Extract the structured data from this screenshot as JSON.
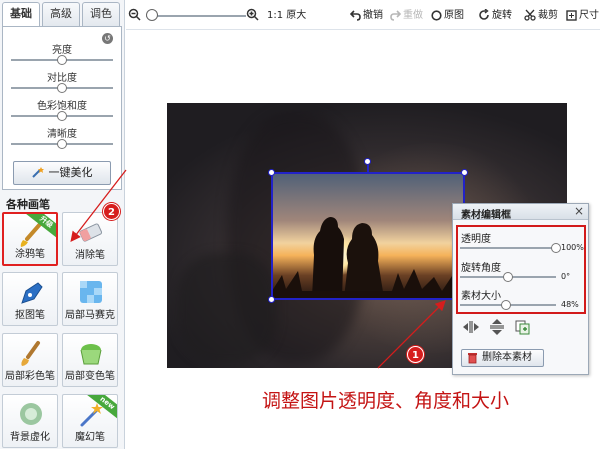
{
  "left_panel": {
    "tabs": [
      {
        "label": "基础",
        "active": true
      },
      {
        "label": "高级",
        "active": false
      },
      {
        "label": "调色",
        "active": false
      }
    ],
    "adjustments": [
      {
        "label": "亮度",
        "value_pct": 50
      },
      {
        "label": "对比度",
        "value_pct": 50
      },
      {
        "label": "色彩饱和度",
        "value_pct": 50
      },
      {
        "label": "清晰度",
        "value_pct": 50
      }
    ],
    "reset_icon": "reset-icon",
    "beautify_label": "一键美化",
    "section_title": "各种画笔",
    "tools": [
      {
        "label": "涂鸦笔",
        "icon": "brush-icon",
        "selected": true,
        "ribbon": "升级"
      },
      {
        "label": "消除笔",
        "icon": "eraser-icon",
        "selected": false,
        "ribbon": ""
      },
      {
        "label": "抠图笔",
        "icon": "pen-cutout-icon",
        "selected": false,
        "ribbon": ""
      },
      {
        "label": "局部马赛克",
        "icon": "mosaic-icon",
        "selected": false,
        "ribbon": ""
      },
      {
        "label": "局部彩色笔",
        "icon": "color-brush-icon",
        "selected": false,
        "ribbon": ""
      },
      {
        "label": "局部变色笔",
        "icon": "paint-bucket-icon",
        "selected": false,
        "ribbon": ""
      },
      {
        "label": "背景虚化",
        "icon": "blur-icon",
        "selected": false,
        "ribbon": ""
      },
      {
        "label": "魔幻笔",
        "icon": "magic-wand-icon",
        "selected": false,
        "ribbon": "new"
      }
    ]
  },
  "toolbar": {
    "zoom_value_pct": 0,
    "actual_size_label": "1:1 原大",
    "undo_label": "撤销",
    "redo_label": "重做",
    "original_label": "原图",
    "rotate_label": "旋转",
    "crop_label": "裁剪",
    "resize_label": "尺寸"
  },
  "material_panel": {
    "title": "素材编辑框",
    "close": "×",
    "opacity": {
      "label": "透明度",
      "value": 100,
      "display": "100%"
    },
    "rotation": {
      "label": "旋转角度",
      "value": 0,
      "display": "0°"
    },
    "size": {
      "label": "素材大小",
      "value": 48,
      "display": "48%"
    },
    "delete_label": "删除本素材"
  },
  "annotations": {
    "badge_1": "1",
    "badge_2": "2",
    "caption": "调整图片透明度、角度和大小"
  },
  "colors": {
    "accent_red": "#d21a1a",
    "selection_blue": "#2222c8",
    "ribbon_green": "#47a83c"
  }
}
